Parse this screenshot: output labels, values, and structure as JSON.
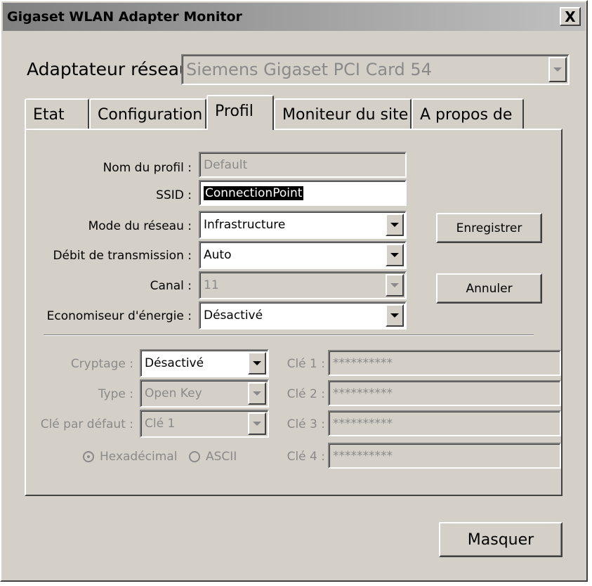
{
  "window": {
    "title": "Gigaset WLAN Adapter Monitor",
    "close_label": "X"
  },
  "adapter": {
    "label": "Adaptateur réseau",
    "value": "Siemens Gigaset PCI Card 54"
  },
  "tabs": [
    {
      "label": "Etat"
    },
    {
      "label": "Configuration"
    },
    {
      "label": "Profil"
    },
    {
      "label": "Moniteur du site"
    },
    {
      "label": "A propos de"
    }
  ],
  "profile": {
    "name_label": "Nom du profil :",
    "name_value": "Default",
    "ssid_label": "SSID :",
    "ssid_value": "ConnectionPoint",
    "mode_label": "Mode du réseau :",
    "mode_value": "Infrastructure",
    "rate_label": "Débit de transmission :",
    "rate_value": "Auto",
    "channel_label": "Canal :",
    "channel_value": "11",
    "power_label": "Economiseur d'énergie :",
    "power_value": "Désactivé"
  },
  "buttons": {
    "save": "Enregistrer",
    "cancel": "Annuler",
    "hide": "Masquer"
  },
  "encryption": {
    "crypt_label": "Cryptage :",
    "crypt_value": "Désactivé",
    "type_label": "Type :",
    "type_value": "Open Key",
    "default_key_label": "Clé par défaut :",
    "default_key_value": "Clé 1",
    "hex_label": "Hexadécimal",
    "ascii_label": "ASCII",
    "keys": [
      {
        "label": "Clé 1 :",
        "value": "**********"
      },
      {
        "label": "Clé 2 :",
        "value": "**********"
      },
      {
        "label": "Clé 3 :",
        "value": "**********"
      },
      {
        "label": "Clé 4 :",
        "value": "**********"
      }
    ]
  }
}
